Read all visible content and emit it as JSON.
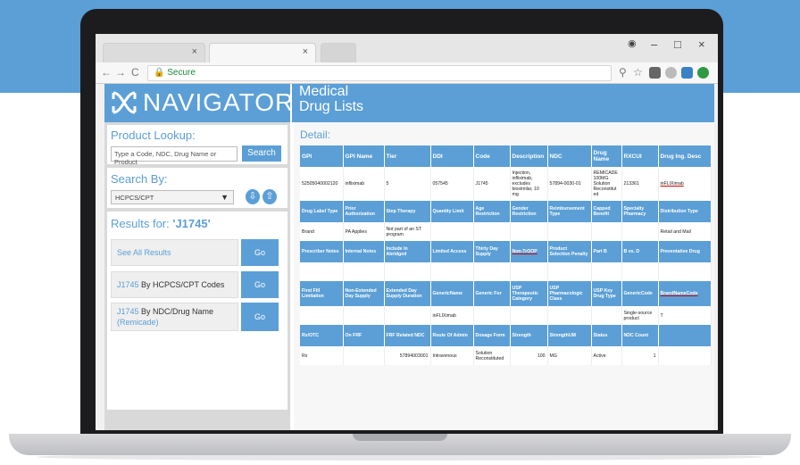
{
  "browser": {
    "tab1_close": "×",
    "tab2_close": "×",
    "back": "←",
    "forward": "→",
    "reload": "C",
    "secure_label": "Secure",
    "window_minimize": "–",
    "window_maximize": "□",
    "window_close": "×"
  },
  "header": {
    "logo_text": "NAVIGATOR",
    "title_line1": "Medical",
    "title_line2": "Drug Lists"
  },
  "sidebar": {
    "lookup_heading": "Product Lookup:",
    "lookup_placeholder": "Type a Code, NDC, Drug Name or Product",
    "search_button": "Search",
    "search_by_heading": "Search By:",
    "search_by_value": "HCPCS/CPT",
    "results_prefix": "Results for: ",
    "results_query": "'J1745'",
    "results": [
      {
        "label": "See All Results",
        "code": "",
        "go": "Go"
      },
      {
        "label": "By HCPCS/CPT Codes",
        "code": "J1745",
        "go": "Go"
      },
      {
        "label": "By NDC/Drug Name",
        "code": "J1745",
        "sub": "(Remicade)",
        "go": "Go"
      }
    ]
  },
  "detail": {
    "heading": "Detail:",
    "header_row1": [
      "GPI",
      "GPI Name",
      "Tier",
      "DDI",
      "Code",
      "Description",
      "NDC",
      "Drug Name",
      "RXCUI",
      "Drug Ing. Desc"
    ],
    "data_row1": [
      "52505040002120",
      "infliximab",
      "5",
      "057545",
      "J1745",
      "Injection, infliximab, excludes biosimilar, 10 mg",
      "57894-0030-01",
      "REMICADE 100MG Solution Reconstitut ed",
      "213361",
      "inFLIXimab"
    ],
    "header_row2": [
      "Drug Label Type",
      "Prior Authorization",
      "Step Therapy",
      "Quantity Limit",
      "Age Restriction",
      "Gender Restriction",
      "Reimbursement Type",
      "Capped Benefit",
      "Specialty Pharmacy",
      "Distribution Type"
    ],
    "data_row2": [
      "Brand",
      "PA Applies",
      "Not part of an ST program",
      "",
      "",
      "",
      "",
      "",
      "",
      "Retail and Mail"
    ],
    "header_row3": [
      "Prescriber Notes",
      "Internal Notes",
      "Include In Abridged",
      "Limited Access",
      "Thirty Day Supply",
      "Non-TrOOP",
      "Product Selection Penalty",
      "Part B",
      "B vs. D",
      "Preventative Drug"
    ],
    "data_row3": [
      "",
      "",
      "",
      "",
      "",
      "",
      "",
      "",
      "",
      ""
    ],
    "header_row4": [
      "First Fill Limitation",
      "Non-Extended Day Supply",
      "Extended Day Supply Duration",
      "GenericName",
      "Generic For",
      "USP Therapeutic Category",
      "USP Pharmacologic Class",
      "USP Key Drug Type",
      "GenericCode",
      "BrandNameCode"
    ],
    "data_row4": [
      "",
      "",
      "",
      "inFLIXimab",
      "",
      "",
      "",
      "",
      "Single-source product",
      "T"
    ],
    "header_row5": [
      "Rx/OTC",
      "On FRF",
      "FRF Related NDC",
      "Route Of Admin",
      "Dosage Form",
      "Strength",
      "StrengthUM",
      "Status",
      "NDC Count",
      ""
    ],
    "data_row5": [
      "Rx",
      "",
      "57894003001",
      "Intravenous",
      "Solution Reconstituted",
      "100",
      "MG",
      "Active",
      "1",
      ""
    ]
  }
}
